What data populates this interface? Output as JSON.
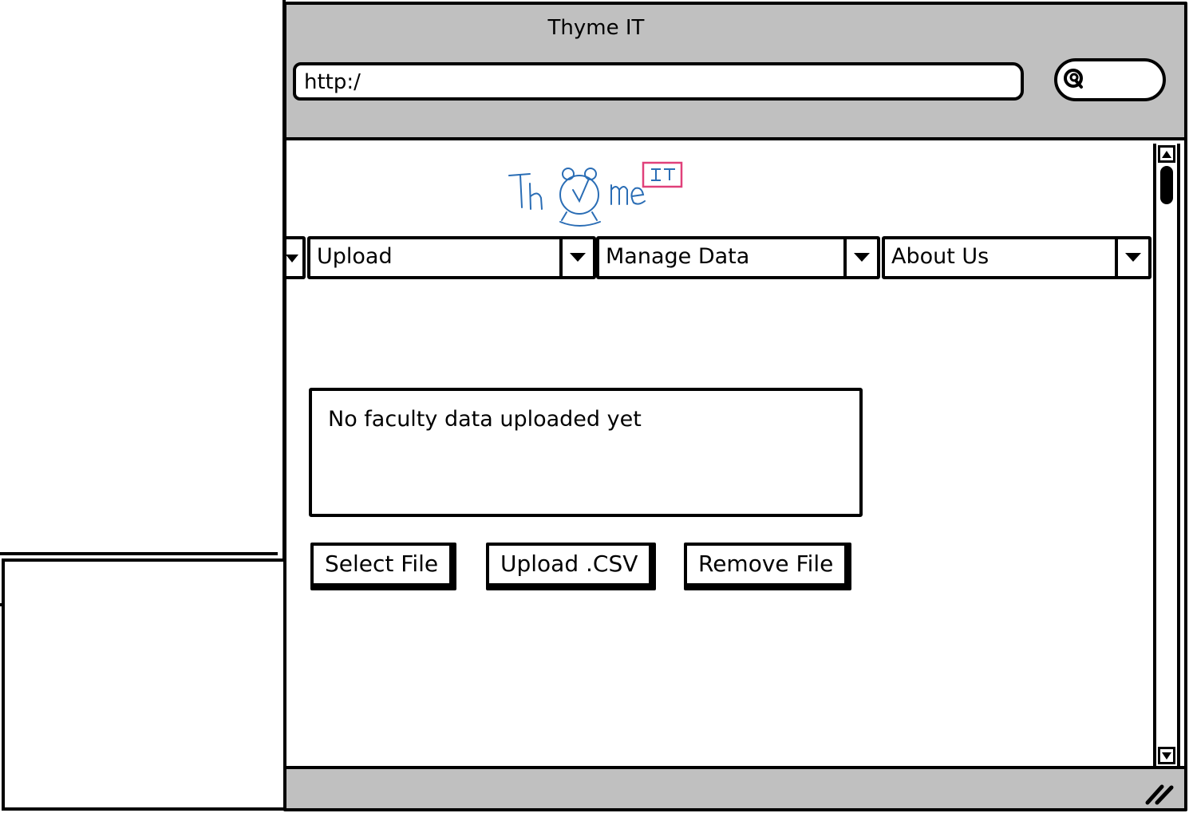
{
  "window": {
    "title": "Thyme IT",
    "url": "http:/"
  },
  "logo": {
    "text_main": "Th",
    "text_tail": "me",
    "badge": "IT"
  },
  "nav": {
    "items": [
      {
        "label": "Upload"
      },
      {
        "label": "Manage Data"
      },
      {
        "label": "About Us"
      }
    ]
  },
  "main": {
    "message": "No faculty data uploaded yet",
    "buttons": {
      "select_file": "Select File",
      "upload_csv": "Upload .CSV",
      "remove_file": "Remove File"
    }
  },
  "colors": {
    "chrome": "#c0c0c0",
    "logo_blue": "#2a6db5",
    "logo_pink": "#e0407a"
  },
  "icons": {
    "search": "search-icon",
    "resize": "resize-grip-icon",
    "dropdown": "chevron-down-icon",
    "scroll_up": "arrow-up-icon",
    "scroll_down": "arrow-down-icon"
  }
}
